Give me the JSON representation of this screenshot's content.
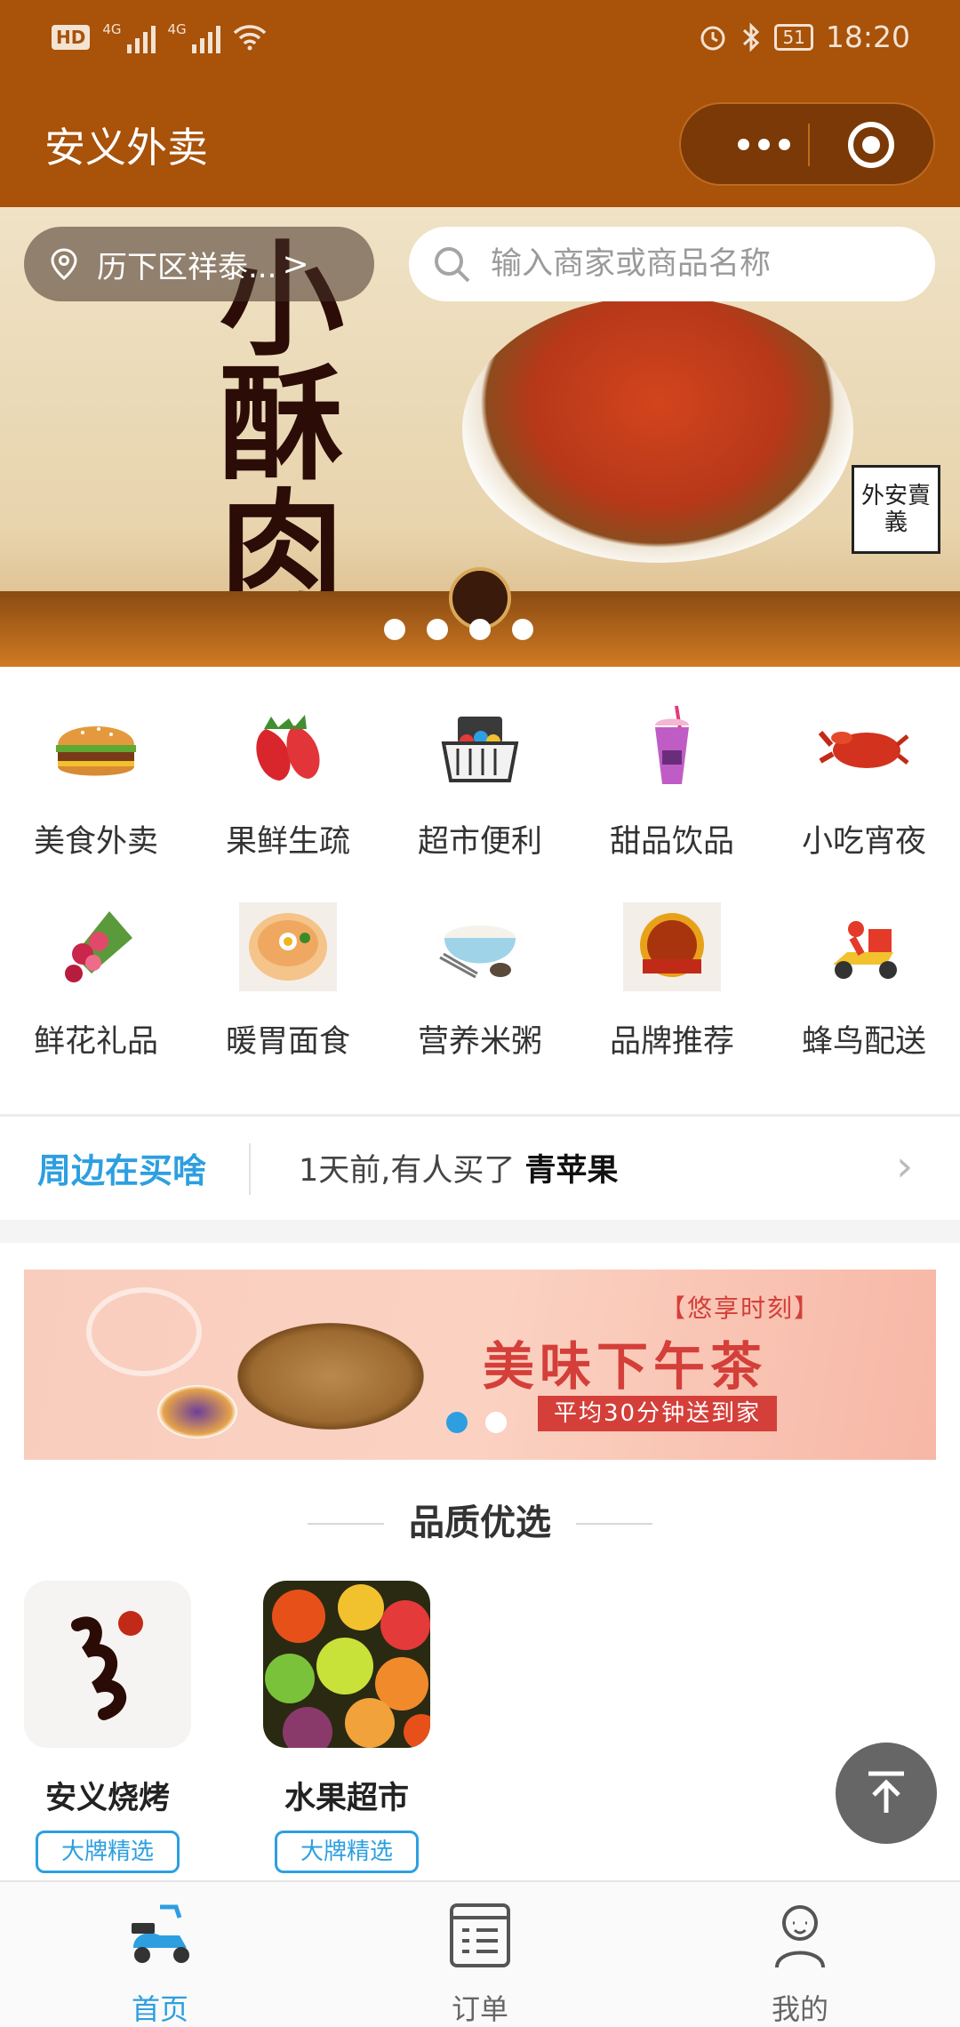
{
  "status_bar": {
    "hd_label": "HD",
    "net1": "4G",
    "net2": "4G",
    "battery": "51",
    "time": "18:20"
  },
  "header": {
    "title": "安义外卖"
  },
  "location": {
    "text": "历下区祥泰...",
    "chevron": ">"
  },
  "search": {
    "placeholder": "输入商家或商品名称"
  },
  "banner": {
    "headline": "小酥肉",
    "seal": "外安賣義",
    "slide_count": 4
  },
  "categories": [
    {
      "label": "美食外卖",
      "icon": "burger-icon"
    },
    {
      "label": "果鲜生疏",
      "icon": "strawberry-icon"
    },
    {
      "label": "超市便利",
      "icon": "shopping-basket-icon"
    },
    {
      "label": "甜品饮品",
      "icon": "drink-icon"
    },
    {
      "label": "小吃宵夜",
      "icon": "crayfish-icon"
    },
    {
      "label": "鲜花礼品",
      "icon": "bouquet-icon"
    },
    {
      "label": "暖胃面食",
      "icon": "noodle-bowl-icon"
    },
    {
      "label": "营养米粥",
      "icon": "porridge-icon"
    },
    {
      "label": "品牌推荐",
      "icon": "brand-badge-icon"
    },
    {
      "label": "蜂鸟配送",
      "icon": "delivery-scooter-icon"
    }
  ],
  "ticker": {
    "tag": "周边在买啥",
    "message_prefix": "1天前,有人买了",
    "message_item": "青苹果"
  },
  "promo": {
    "sub": "【悠享时刻】",
    "main": "美味下午茶",
    "pill": "平均30分钟送到家",
    "active_slide": 1,
    "slide_count": 2
  },
  "quality": {
    "title": "品质优选",
    "shops": [
      {
        "name": "安义烧烤",
        "badge": "大牌精选"
      },
      {
        "name": "水果超市",
        "badge": "大牌精选"
      }
    ]
  },
  "tabbar": {
    "tabs": [
      {
        "label": "首页",
        "icon": "scooter-home-icon",
        "active": true
      },
      {
        "label": "订单",
        "icon": "order-list-icon",
        "active": false
      },
      {
        "label": "我的",
        "icon": "user-profile-icon",
        "active": false
      }
    ]
  },
  "colors": {
    "brand": "#a8520a",
    "accent": "#2d9fe0",
    "promo_red": "#d43f3a"
  }
}
